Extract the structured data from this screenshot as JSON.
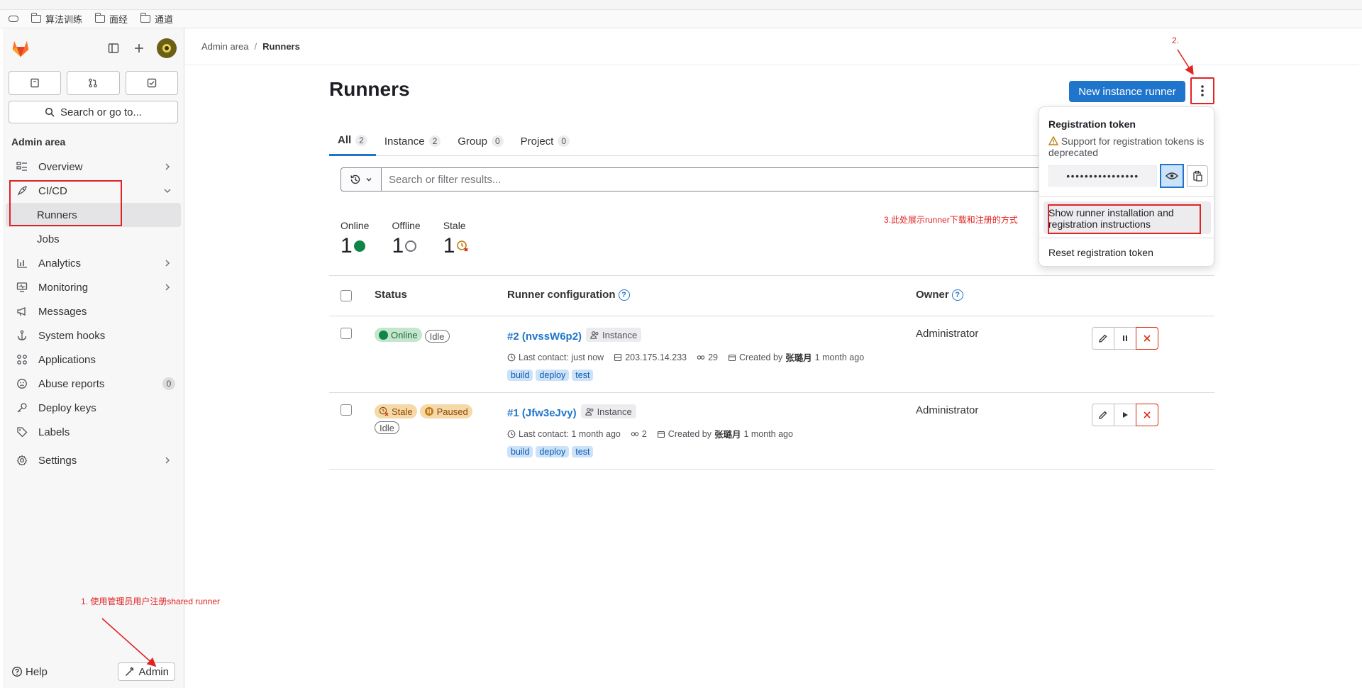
{
  "bookmarks": [
    "算法训练",
    "面经",
    "通道"
  ],
  "breadcrumb": {
    "root": "Admin area",
    "current": "Runners"
  },
  "sidebar": {
    "search_label": "Search or go to...",
    "section": "Admin area",
    "items": [
      {
        "label": "Overview"
      },
      {
        "label": "CI/CD"
      },
      {
        "label": "Runners"
      },
      {
        "label": "Jobs"
      },
      {
        "label": "Analytics"
      },
      {
        "label": "Monitoring"
      },
      {
        "label": "Messages"
      },
      {
        "label": "System hooks"
      },
      {
        "label": "Applications"
      },
      {
        "label": "Abuse reports",
        "badge": "0"
      },
      {
        "label": "Deploy keys"
      },
      {
        "label": "Labels"
      },
      {
        "label": "Settings"
      }
    ],
    "help_label": "Help",
    "admin_label": "Admin"
  },
  "page": {
    "title": "Runners",
    "new_runner_label": "New instance runner",
    "tabs": [
      {
        "label": "All",
        "count": "2"
      },
      {
        "label": "Instance",
        "count": "2"
      },
      {
        "label": "Group",
        "count": "0"
      },
      {
        "label": "Project",
        "count": "0"
      }
    ],
    "filter_placeholder": "Search or filter results...",
    "stats": [
      {
        "label": "Online",
        "value": "1"
      },
      {
        "label": "Offline",
        "value": "1"
      },
      {
        "label": "Stale",
        "value": "1"
      }
    ],
    "columns": {
      "status": "Status",
      "config": "Runner configuration",
      "owner": "Owner"
    }
  },
  "runners": [
    {
      "status1": "Online",
      "status2": "Idle",
      "name": "#2 (nvssW6p2)",
      "type": "Instance",
      "last_contact": "Last contact: just now",
      "ip": "203.175.14.233",
      "jobs": "29",
      "created_prefix": "Created by",
      "created_by": "张璐月",
      "created_when": "1 month ago",
      "tags": [
        "build",
        "deploy",
        "test"
      ],
      "owner": "Administrator"
    },
    {
      "status1": "Stale",
      "status2": "Paused",
      "status3": "Idle",
      "name": "#1 (Jfw3eJvy)",
      "type": "Instance",
      "last_contact": "Last contact: 1 month ago",
      "jobs": "2",
      "created_prefix": "Created by",
      "created_by": "张璐月",
      "created_when": "1 month ago",
      "tags": [
        "build",
        "deploy",
        "test"
      ],
      "owner": "Administrator"
    }
  ],
  "dropdown": {
    "title": "Registration token",
    "warning": "Support for registration tokens is deprecated",
    "token_masked": "••••••••••••••••",
    "show_instructions": "Show runner installation and registration instructions",
    "reset": "Reset registration token"
  },
  "annotations": {
    "a1": "1. 使用管理员用户注册shared runner",
    "a2": "2.",
    "a3": "3.此处展示runner下载和注册的方式"
  },
  "colors": {
    "accent": "#1f75cb",
    "annotation": "#e02424",
    "online": "#108548",
    "logo": "#fc6d26"
  }
}
